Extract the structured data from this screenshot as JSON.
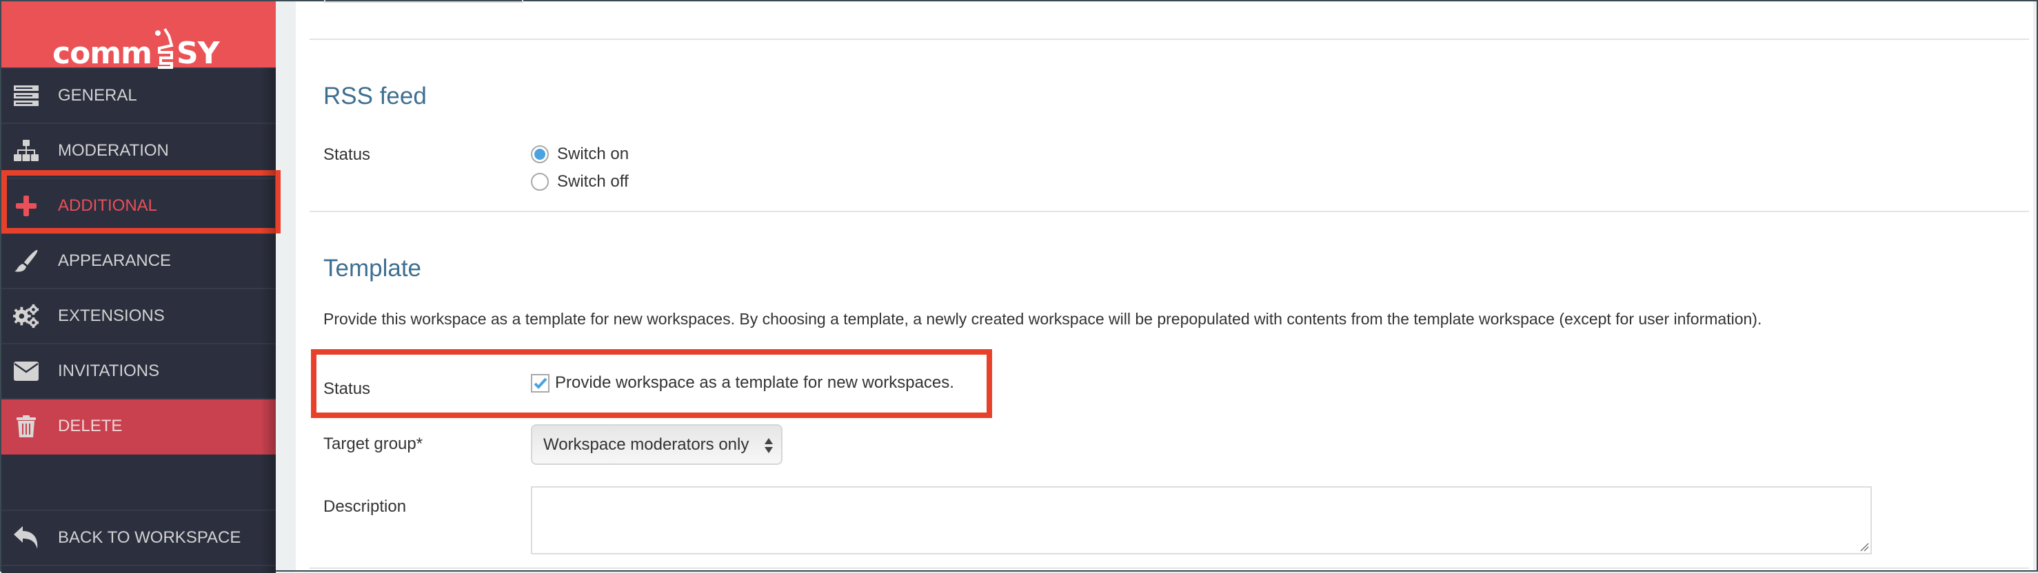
{
  "app": {
    "logo_left": "comm",
    "logo_right": "SY"
  },
  "sidebar": {
    "items": [
      {
        "label": "GENERAL",
        "icon": "server-stack-icon",
        "state": "normal"
      },
      {
        "label": "MODERATION",
        "icon": "sitemap-icon",
        "state": "normal"
      },
      {
        "label": "ADDITIONAL",
        "icon": "plus-icon",
        "state": "active"
      },
      {
        "label": "APPEARANCE",
        "icon": "paintbrush-icon",
        "state": "normal"
      },
      {
        "label": "EXTENSIONS",
        "icon": "gears-icon",
        "state": "normal"
      },
      {
        "label": "INVITATIONS",
        "icon": "envelope-icon",
        "state": "normal"
      },
      {
        "label": "DELETE",
        "icon": "trash-icon",
        "state": "danger"
      }
    ],
    "back": {
      "label": "BACK TO WORKSPACE",
      "icon": "reply-arrow-icon"
    }
  },
  "rss": {
    "title": "RSS feed",
    "status_label": "Status",
    "options": [
      {
        "label": "Switch on",
        "checked": true
      },
      {
        "label": "Switch off",
        "checked": false
      }
    ]
  },
  "template": {
    "title": "Template",
    "description": "Provide this workspace as a template for new workspaces. By choosing a template, a newly created workspace will be prepopulated with contents from the template workspace (except for user information).",
    "status_label": "Status",
    "status_checkbox_label": "Provide workspace as a template for new workspaces.",
    "status_checked": true,
    "target_group_label": "Target group*",
    "target_group_value": "Workspace moderators only",
    "description_label": "Description",
    "description_value": ""
  },
  "colors": {
    "brand_red": "#eb5256",
    "sidebar_bg": "#2c2f3e",
    "active_text": "#e9505a",
    "delete_bg": "#c9414f",
    "heading_blue": "#3e6f91",
    "annotation_red": "#e8412b",
    "check_blue": "#4aa3e0"
  }
}
